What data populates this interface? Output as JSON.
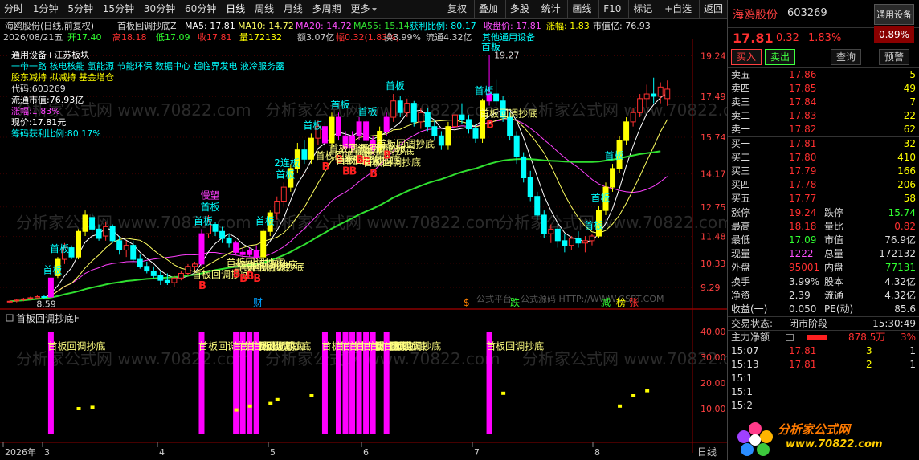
{
  "toolbar": {
    "periods": [
      "分时",
      "1分钟",
      "5分钟",
      "15分钟",
      "30分钟",
      "60分钟",
      "日线",
      "周线",
      "月线",
      "多周期",
      "更多"
    ],
    "active_period": "日线",
    "buttons": [
      "复权",
      "叠加",
      "多股",
      "统计",
      "画线",
      "F10",
      "标记",
      "+自选",
      "返回"
    ]
  },
  "main_panel": {
    "info_line1": {
      "stock": "海鸥股份(日线,前复权)",
      "indicator": "首板回调抄底Z",
      "ma5": "MA5: 17.81",
      "ma10": "MA10: 14.72",
      "ma20": "MA20: 14.72",
      "ma55": "MA55: 15.14",
      "profit": "获利比例: 80.17",
      "close": "收盘价: 17.81",
      "change": "涨幅: 1.83",
      "mktcap": "市值亿: 76.93"
    },
    "info_line2": {
      "date": "2026/08/21五",
      "open": "开17.40",
      "high": "高18.18",
      "low": "低17.09",
      "close": "收17.81",
      "vol": "量172132",
      "amount": "额3.07亿",
      "range": "幅0.32(1.83%)",
      "turnover": "换3.99%",
      "float": "流通4.32亿",
      "sector": "其他通用设备"
    },
    "overlay_text": [
      "通用设备+江苏板块",
      "一带一路 核电核能 氢能源 节能环保 数据中心 超临界发电 液冷服务器",
      "股东减持 拟减持 基金增仓",
      "代码:603269",
      "流通市值:76.93亿",
      "涨幅:1.83%",
      "现价:17.81元",
      "筹码获利比例:80.17%"
    ],
    "right_axis": [
      "19.24",
      "17.49",
      "15.74",
      "14.17",
      "12.75",
      "11.48",
      "10.33",
      "9.29"
    ],
    "price_high_label": "19.27",
    "price_low_label": "8.59",
    "markers": {
      "board": "首板",
      "rebound": "首板回调抄底",
      "buy": "B",
      "lianban": "2连板",
      "yiwang": "慢望",
      "cai": "财",
      "s": "$",
      "die": "跌",
      "jian": "减",
      "bang": "榜",
      "zhang": "张"
    },
    "watermark": "分析家公式网 www.70822.com",
    "watermark2": "公式平台、公式源码 HTTP://WWW.GSPT.COM"
  },
  "sub_panel": {
    "title": "首板回调抄底F",
    "axis": [
      "40.00",
      "30.00",
      "20.00",
      "10.00"
    ]
  },
  "x_axis": {
    "labels": [
      "2026年",
      "3",
      "4",
      "5",
      "6",
      "7",
      "8"
    ],
    "period": "日线"
  },
  "sidebar": {
    "name": "海鸥股份",
    "code": "603269",
    "badge": "通用设备",
    "badge_change": "0.89%",
    "price": "17.81",
    "change": "0.32",
    "change_pct": "1.83%",
    "buttons": [
      "买入",
      "卖出",
      "查询",
      "预警"
    ],
    "asks": [
      {
        "label": "卖五",
        "price": "17.86",
        "vol": "5"
      },
      {
        "label": "卖四",
        "price": "17.85",
        "vol": "49"
      },
      {
        "label": "卖三",
        "price": "17.84",
        "vol": "7"
      },
      {
        "label": "卖二",
        "price": "17.83",
        "vol": "22"
      },
      {
        "label": "卖一",
        "price": "17.82",
        "vol": "62"
      }
    ],
    "bids": [
      {
        "label": "买一",
        "price": "17.81",
        "vol": "32"
      },
      {
        "label": "买二",
        "price": "17.80",
        "vol": "410"
      },
      {
        "label": "买三",
        "price": "17.79",
        "vol": "166"
      },
      {
        "label": "买四",
        "price": "17.78",
        "vol": "206"
      },
      {
        "label": "买五",
        "price": "17.77",
        "vol": "58"
      }
    ],
    "stats": [
      [
        "涨停",
        "19.24",
        "跌停",
        "15.74"
      ],
      [
        "最高",
        "18.18",
        "量比",
        "0.82"
      ],
      [
        "最低",
        "17.09",
        "市值",
        "76.9亿"
      ],
      [
        "现量",
        "1222",
        "总量",
        "172132"
      ],
      [
        "外盘",
        "95001",
        "内盘",
        "77131"
      ]
    ],
    "stats2": [
      [
        "换手",
        "3.99%",
        "股本",
        "4.32亿"
      ],
      [
        "净资",
        "2.39",
        "流通",
        "4.32亿"
      ],
      [
        "收益(一)",
        "0.050",
        "PE(动)",
        "85.6"
      ]
    ],
    "trade_state": {
      "label": "交易状态:",
      "state": "闭市阶段",
      "time": "15:30:49"
    },
    "main_flow": {
      "label": "主力净额",
      "value": "878.5万",
      "pct": "3%"
    },
    "ticks": [
      {
        "time": "15:07",
        "price": "17.81",
        "vol": "3",
        "n": "1"
      },
      {
        "time": "15:13",
        "price": "17.81",
        "vol": "2",
        "n": "1"
      },
      {
        "time": "15:1",
        "price": "",
        "vol": "",
        "n": ""
      },
      {
        "time": "15:1",
        "price": "",
        "vol": "",
        "n": ""
      },
      {
        "time": "15:2",
        "price": "",
        "vol": "",
        "n": ""
      }
    ],
    "logo": {
      "name": "分析家公式网",
      "url": "www.70822.com"
    }
  },
  "colors": {
    "up": "#ff3030",
    "down": "#00ffff",
    "ma5": "#ffffff",
    "ma10": "#ffff60",
    "ma20": "#ff40ff",
    "ma55": "#30e030",
    "signal": "#ff00ff",
    "dot": "#ffff00",
    "grid": "#8b0000"
  },
  "chart_data": {
    "type": "candlestick",
    "title": "海鸥股份(日线,前复权)",
    "ylim": [
      8.4,
      19.6
    ],
    "candles": [
      [
        8.7,
        8.75,
        8.6,
        8.7
      ],
      [
        8.72,
        8.8,
        8.65,
        8.75
      ],
      [
        8.8,
        8.85,
        8.7,
        8.8
      ],
      [
        8.82,
        8.9,
        8.75,
        8.85
      ],
      [
        8.85,
        8.95,
        8.8,
        8.9
      ],
      [
        8.9,
        8.95,
        8.8,
        8.88
      ],
      [
        8.88,
        9.7,
        8.85,
        9.7
      ],
      [
        9.8,
        10.6,
        9.7,
        10.5
      ],
      [
        10.5,
        11.2,
        10.3,
        11.0
      ],
      [
        11.0,
        11.1,
        10.5,
        10.6
      ],
      [
        10.6,
        11.8,
        10.5,
        11.7
      ],
      [
        11.7,
        12.6,
        11.5,
        12.4
      ],
      [
        12.3,
        12.5,
        11.6,
        11.8
      ],
      [
        11.8,
        12.0,
        11.3,
        11.4
      ],
      [
        11.5,
        12.1,
        11.3,
        11.9
      ],
      [
        11.9,
        12.0,
        11.2,
        11.3
      ],
      [
        11.3,
        11.5,
        10.7,
        10.9
      ],
      [
        10.9,
        11.3,
        10.6,
        11.1
      ],
      [
        11.1,
        11.3,
        10.4,
        10.5
      ],
      [
        10.5,
        10.7,
        10.1,
        10.2
      ],
      [
        10.2,
        10.4,
        9.9,
        10.0
      ],
      [
        10.0,
        10.2,
        9.7,
        9.8
      ],
      [
        9.8,
        10.0,
        9.4,
        9.6
      ],
      [
        9.6,
        9.9,
        9.4,
        9.5
      ],
      [
        9.5,
        9.8,
        9.3,
        9.7
      ],
      [
        9.7,
        10.0,
        9.6,
        9.9
      ],
      [
        9.9,
        10.3,
        9.8,
        10.2
      ],
      [
        10.2,
        10.4,
        10.0,
        10.3
      ],
      [
        10.3,
        11.8,
        10.2,
        11.6
      ],
      [
        11.6,
        12.4,
        11.4,
        12.1
      ],
      [
        12.0,
        12.1,
        11.5,
        11.7
      ],
      [
        11.7,
        11.9,
        11.2,
        11.4
      ],
      [
        11.4,
        11.6,
        11.0,
        11.2
      ],
      [
        11.2,
        11.3,
        10.7,
        10.8
      ],
      [
        10.8,
        11.0,
        10.5,
        10.7
      ],
      [
        10.7,
        11.0,
        10.6,
        10.9
      ],
      [
        10.9,
        11.1,
        10.5,
        10.6
      ],
      [
        10.6,
        11.8,
        10.5,
        11.7
      ],
      [
        11.7,
        12.6,
        11.5,
        12.5
      ],
      [
        12.5,
        13.2,
        12.2,
        13.0
      ],
      [
        13.0,
        13.8,
        12.8,
        13.6
      ],
      [
        13.6,
        14.6,
        13.4,
        14.4
      ],
      [
        14.4,
        15.5,
        14.2,
        15.2
      ],
      [
        15.2,
        15.6,
        14.6,
        14.8
      ],
      [
        14.8,
        15.9,
        14.6,
        15.7
      ],
      [
        15.7,
        16.5,
        15.4,
        16.2
      ],
      [
        16.2,
        16.4,
        15.3,
        15.5
      ],
      [
        15.5,
        16.8,
        15.3,
        16.6
      ],
      [
        16.6,
        16.8,
        15.6,
        15.8
      ],
      [
        15.8,
        16.0,
        15.1,
        15.3
      ],
      [
        15.3,
        16.0,
        15.1,
        15.8
      ],
      [
        15.8,
        16.6,
        15.6,
        16.4
      ],
      [
        16.4,
        16.5,
        15.5,
        15.6
      ],
      [
        15.6,
        15.8,
        15.0,
        15.2
      ],
      [
        15.2,
        16.2,
        15.0,
        16.0
      ],
      [
        16.0,
        16.8,
        15.8,
        16.6
      ],
      [
        16.6,
        17.6,
        16.4,
        17.3
      ],
      [
        17.3,
        17.5,
        16.6,
        16.8
      ],
      [
        16.8,
        17.4,
        16.6,
        17.2
      ],
      [
        17.2,
        17.3,
        16.2,
        16.4
      ],
      [
        16.4,
        17.0,
        16.1,
        16.8
      ],
      [
        16.8,
        17.0,
        16.0,
        16.2
      ],
      [
        16.2,
        16.5,
        15.6,
        15.8
      ],
      [
        15.8,
        16.0,
        15.2,
        15.4
      ],
      [
        15.4,
        16.4,
        15.2,
        16.2
      ],
      [
        16.2,
        16.9,
        16.0,
        16.7
      ],
      [
        16.7,
        17.2,
        16.3,
        16.5
      ],
      [
        16.5,
        16.7,
        15.9,
        16.1
      ],
      [
        16.1,
        16.3,
        15.5,
        15.7
      ],
      [
        15.7,
        17.4,
        15.5,
        17.3
      ],
      [
        17.3,
        19.27,
        17.1,
        17.6
      ],
      [
        17.6,
        18.2,
        17.1,
        17.3
      ],
      [
        17.3,
        17.5,
        16.4,
        16.6
      ],
      [
        16.6,
        16.8,
        15.6,
        15.8
      ],
      [
        15.8,
        16.0,
        14.6,
        14.9
      ],
      [
        14.9,
        15.1,
        13.8,
        14.0
      ],
      [
        14.0,
        14.3,
        13.0,
        13.2
      ],
      [
        13.2,
        13.4,
        12.2,
        12.4
      ],
      [
        12.4,
        12.6,
        11.4,
        11.6
      ],
      [
        11.6,
        12.0,
        11.2,
        11.8
      ],
      [
        11.8,
        12.0,
        11.0,
        11.3
      ],
      [
        11.3,
        11.6,
        10.8,
        11.1
      ],
      [
        11.1,
        11.5,
        10.9,
        11.4
      ],
      [
        11.4,
        11.7,
        11.0,
        11.2
      ],
      [
        11.2,
        11.5,
        10.8,
        11.3
      ],
      [
        11.3,
        11.6,
        11.1,
        11.5
      ],
      [
        11.5,
        12.8,
        11.4,
        12.6
      ],
      [
        12.6,
        13.8,
        12.4,
        13.6
      ],
      [
        13.6,
        14.6,
        13.4,
        14.4
      ],
      [
        14.4,
        15.8,
        14.2,
        15.6
      ],
      [
        15.6,
        16.6,
        15.4,
        16.4
      ],
      [
        16.4,
        17.0,
        16.2,
        16.8
      ],
      [
        16.8,
        17.6,
        16.6,
        17.4
      ],
      [
        17.4,
        18.0,
        17.0,
        17.6
      ],
      [
        17.6,
        18.3,
        17.2,
        17.5
      ],
      [
        17.5,
        18.1,
        17.2,
        17.9
      ],
      [
        17.4,
        18.18,
        17.09,
        17.81
      ]
    ],
    "ma55": [
      8.7,
      8.72,
      8.74,
      8.77,
      8.8,
      8.82,
      8.86,
      8.92,
      9.0,
      9.06,
      9.13,
      9.22,
      9.29,
      9.35,
      9.42,
      9.48,
      9.52,
      9.57,
      9.6,
      9.63,
      9.66,
      9.68,
      9.7,
      9.72,
      9.74,
      9.77,
      9.8,
      9.84,
      9.9,
      9.98,
      10.04,
      10.09,
      10.14,
      10.18,
      10.22,
      10.26,
      10.3,
      10.36,
      10.45,
      10.56,
      10.68,
      10.82,
      10.98,
      11.13,
      11.3,
      11.48,
      11.64,
      11.82,
      11.98,
      12.12,
      12.27,
      12.43,
      12.56,
      12.68,
      12.82,
      12.98,
      13.15,
      13.28,
      13.42,
      13.54,
      13.66,
      13.77,
      13.86,
      13.94,
      14.04,
      14.15,
      14.25,
      14.33,
      14.4,
      14.5,
      14.6,
      14.68,
      14.74,
      14.78,
      14.8,
      14.81,
      14.8,
      14.78,
      14.75,
      14.73,
      14.72,
      14.7,
      14.69,
      14.68,
      14.68,
      14.68,
      14.7,
      14.74,
      14.78,
      14.84,
      14.9,
      14.96,
      15.02,
      15.06,
      15.1,
      15.14
    ],
    "signals": [
      6,
      28,
      33,
      34,
      35,
      36,
      46,
      48,
      49,
      50,
      51,
      52,
      53,
      55,
      70
    ],
    "boards": [
      6,
      7,
      28,
      29,
      37,
      40,
      44,
      48,
      52,
      56,
      69,
      70,
      85,
      86,
      88
    ],
    "dots": [
      {
        "i": 10,
        "v": 10
      },
      {
        "i": 12,
        "v": 10.5
      },
      {
        "i": 33,
        "v": 9.5
      },
      {
        "i": 35,
        "v": 11
      },
      {
        "i": 38,
        "v": 12
      },
      {
        "i": 39,
        "v": 13.5
      },
      {
        "i": 44,
        "v": 15
      },
      {
        "i": 72,
        "v": 16
      },
      {
        "i": 89,
        "v": 11
      },
      {
        "i": 91,
        "v": 15
      },
      {
        "i": 93,
        "v": 17
      }
    ]
  }
}
